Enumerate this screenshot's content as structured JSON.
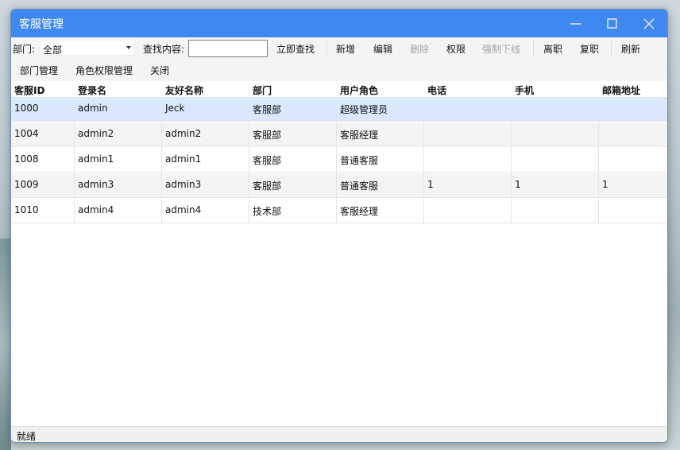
{
  "window": {
    "title": "客服管理"
  },
  "toolbar": {
    "department_label": "部门:",
    "department_selected": "全部",
    "search_label": "查找内容:",
    "search_value": "",
    "search_now": "立即查找",
    "add": "新增",
    "edit": "编辑",
    "delete": "删除",
    "permission": "权限",
    "force_offline": "强制下线",
    "resign": "离职",
    "rehire": "复职",
    "refresh": "刷新"
  },
  "toolbar2": {
    "dept_manage": "部门管理",
    "role_manage": "角色权限管理",
    "close": "关闭"
  },
  "table": {
    "columns": [
      "客服ID",
      "登录名",
      "友好名称",
      "部门",
      "用户角色",
      "电话",
      "手机",
      "邮箱地址"
    ],
    "rows": [
      [
        "1000",
        "admin",
        "Jeck",
        "客服部",
        "超级管理员",
        "",
        "",
        ""
      ],
      [
        "1004",
        "admin2",
        "admin2",
        "客服部",
        "客服经理",
        "",
        "",
        ""
      ],
      [
        "1008",
        "admin1",
        "admin1",
        "客服部",
        "普通客服",
        "",
        "",
        ""
      ],
      [
        "1009",
        "admin3",
        "admin3",
        "客服部",
        "普通客服",
        "1",
        "1",
        "1"
      ],
      [
        "1010",
        "admin4",
        "admin4",
        "技术部",
        "客服经理",
        "",
        "",
        ""
      ]
    ],
    "selected_row": 0
  },
  "status": {
    "text": "就绪"
  },
  "colors": {
    "titlebar": "#3f88f0",
    "selected_row": "#d9e8fb",
    "alt_row": "#f3f4f6"
  }
}
